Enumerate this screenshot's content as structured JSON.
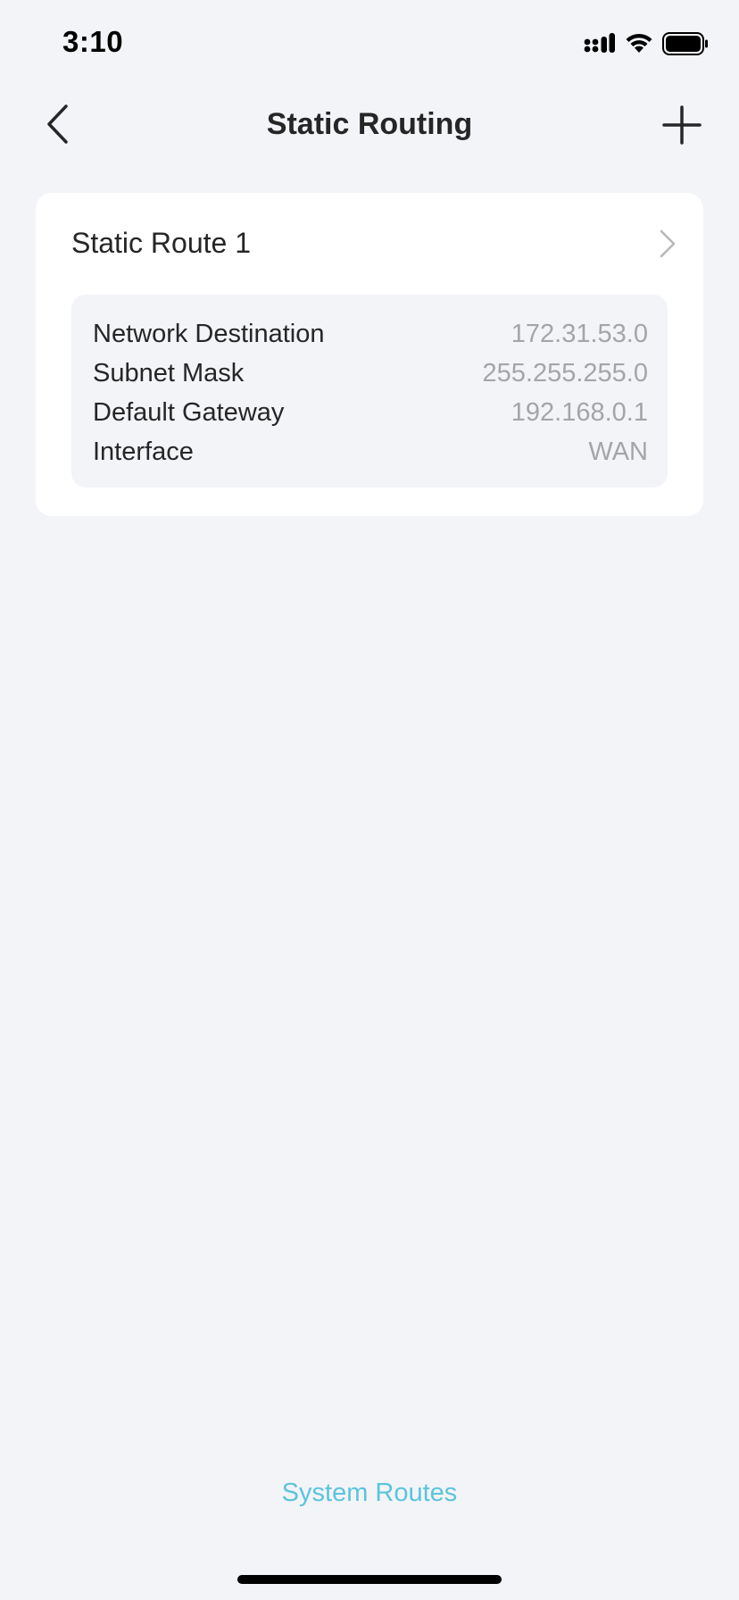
{
  "status_bar": {
    "time": "3:10",
    "icons": [
      "cellular-signal-icon",
      "wifi-icon",
      "battery-icon"
    ]
  },
  "nav": {
    "title": "Static Routing",
    "back_icon": "chevron-left-icon",
    "add_icon": "plus-icon"
  },
  "route": {
    "name": "Static Route 1",
    "details": [
      {
        "label": "Network Destination",
        "value": "172.31.53.0"
      },
      {
        "label": "Subnet Mask",
        "value": "255.255.255.0"
      },
      {
        "label": "Default Gateway",
        "value": "192.168.0.1"
      },
      {
        "label": "Interface",
        "value": "WAN"
      }
    ]
  },
  "footer": {
    "system_routes_label": "System Routes"
  },
  "colors": {
    "background": "#f3f4f8",
    "card": "#ffffff",
    "label": "#262626",
    "value": "#a3a5a9",
    "link": "#5bc4dd"
  }
}
